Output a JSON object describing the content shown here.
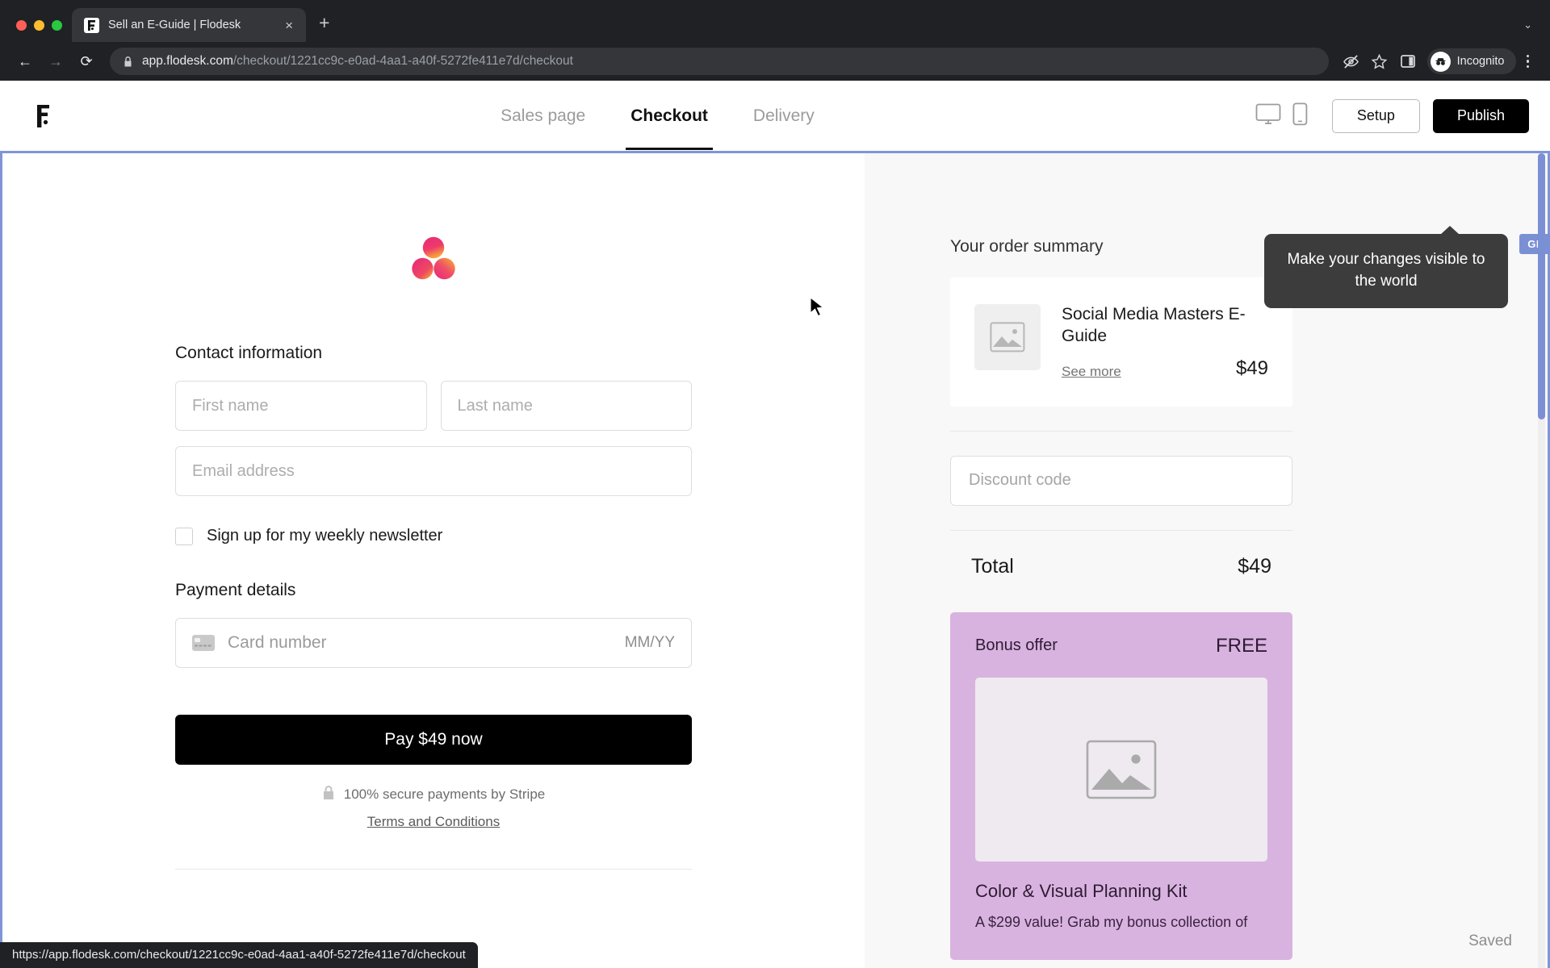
{
  "browser": {
    "tab": {
      "title": "Sell an E-Guide | Flodesk",
      "favicon": "flodesk-f-icon",
      "close": "×"
    },
    "new_tab_label": "+",
    "tab_list_chevron": "⌄",
    "nav": {
      "back": "←",
      "forward": "→",
      "reload": "⟳"
    },
    "url": {
      "domain": "app.flodesk.com",
      "path": "/checkout/1221cc9c-e0ad-4aa1-a40f-5272fe411e7d/checkout",
      "lock": "lock-icon"
    },
    "toolbar": {
      "incognito_label": "Incognito"
    }
  },
  "status_bar": {
    "url": "https://app.flodesk.com/checkout/1221cc9c-e0ad-4aa1-a40f-5272fe411e7d/checkout"
  },
  "app": {
    "nav_tabs": [
      {
        "label": "Sales page",
        "active": false
      },
      {
        "label": "Checkout",
        "active": true
      },
      {
        "label": "Delivery",
        "active": false
      }
    ],
    "setup_label": "Setup",
    "publish_label": "Publish",
    "tooltip": "Make your changes visible to the world",
    "edge_badge": "GE",
    "saved_label": "Saved"
  },
  "checkout": {
    "contact_heading": "Contact information",
    "first_name_placeholder": "First name",
    "last_name_placeholder": "Last name",
    "email_placeholder": "Email address",
    "newsletter_label": "Sign up for my weekly newsletter",
    "payment_heading": "Payment details",
    "card_placeholder": "Card number",
    "card_expiry_placeholder": "MM/YY",
    "pay_button": "Pay $49 now",
    "secure_note": "100% secure payments by Stripe",
    "terms_link": "Terms and Conditions"
  },
  "summary": {
    "heading": "Your order summary",
    "product": {
      "name": "Social Media Masters E-Guide",
      "see_more": "See more",
      "price": "$49"
    },
    "discount_placeholder": "Discount code",
    "total_label": "Total",
    "total_value": "$49",
    "bonus": {
      "label": "Bonus offer",
      "price": "FREE",
      "name": "Color & Visual Planning Kit",
      "description": "A $299 value! Grab my bonus collection of"
    }
  },
  "colors": {
    "accent_border": "#8095d8",
    "publish_bg": "#000000",
    "bonus_bg": "#d9b3e0",
    "badge_bg": "#7b8fd4"
  }
}
